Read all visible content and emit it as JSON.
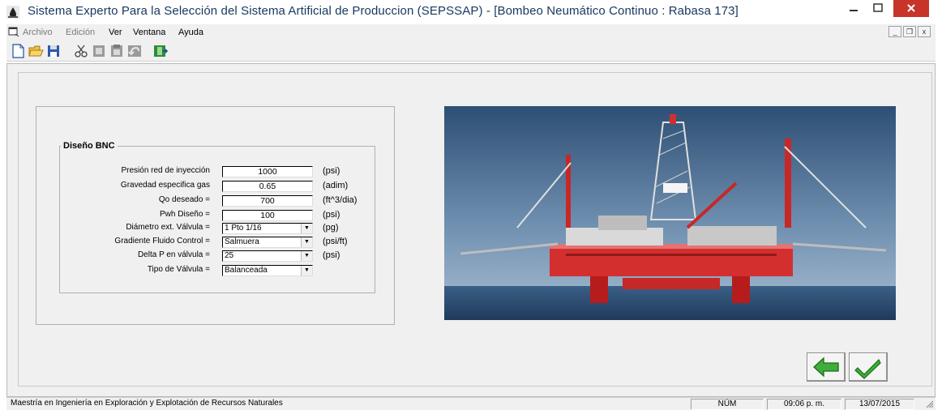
{
  "window": {
    "title": "Sistema Experto Para la Selección del Sistema Artificial de Produccion (SEPSSAP) - [Bombeo Neumático Continuo : Rabasa 173]",
    "icon": "oil-drop-icon",
    "controls": {
      "minimize": "–",
      "maximize": "▭",
      "close": "✕"
    },
    "accent_close": "#c7352a"
  },
  "menu": {
    "items": [
      {
        "label": "Archivo",
        "enabled": false
      },
      {
        "label": "Edición",
        "enabled": false
      },
      {
        "label": "Ver",
        "enabled": true
      },
      {
        "label": "Ventana",
        "enabled": true
      },
      {
        "label": "Ayuda",
        "enabled": true
      }
    ],
    "mdi_controls": {
      "minimize": "_",
      "restore": "❐",
      "close": "x"
    }
  },
  "toolbar": {
    "buttons": [
      "new-icon",
      "open-folder-icon",
      "save-icon",
      "cut-icon",
      "copy-icon",
      "paste-icon",
      "undo-icon",
      "exit-icon"
    ]
  },
  "form": {
    "group_title": "Diseño BNC",
    "fields": [
      {
        "label": "Presión red de inyección",
        "value": "1000",
        "unit": "(psi)"
      },
      {
        "label": "Gravedad especifica gas",
        "value": "0.65",
        "unit": "(adim)"
      },
      {
        "label": "Qo deseado =",
        "value": "700",
        "unit": "(ft^3/dia)"
      },
      {
        "label": "Pwh Diseño =",
        "value": "100",
        "unit": "(psi)"
      }
    ],
    "selects": [
      {
        "label": "Diámetro ext. Válvula =",
        "value": "1 Pto 1/16",
        "unit": "(pg)"
      },
      {
        "label": "Gradiente Fluido Control =",
        "value": "Salmuera",
        "unit": "(psi/ft)"
      },
      {
        "label": "Delta P en válvula =",
        "value": "25",
        "unit": "(psi)"
      },
      {
        "label": "Tipo de Válvula =",
        "value": "Balanceada",
        "unit": ""
      }
    ]
  },
  "photo": {
    "subject": "offshore-drilling-platform-image"
  },
  "actions": {
    "back": "back-arrow-icon",
    "confirm": "checkmark-icon"
  },
  "status": {
    "message": "Maestría en Ingeniería en Exploración y Explotación de Recursos Naturales",
    "num": "NÚM",
    "time": "09:06 p. m.",
    "date": "13/07/2015"
  }
}
